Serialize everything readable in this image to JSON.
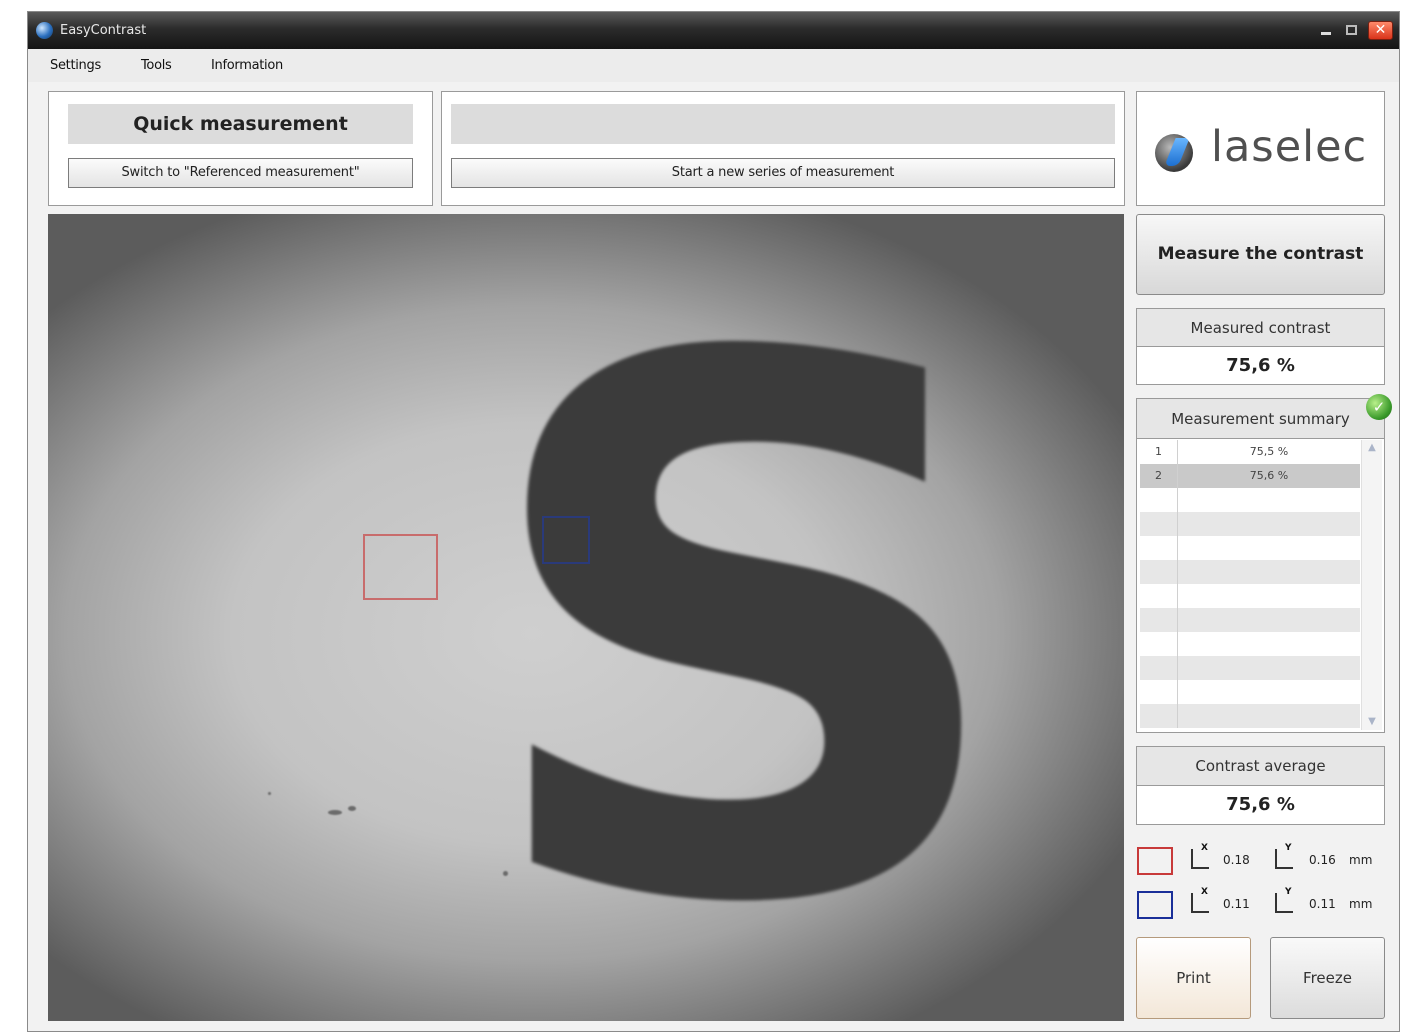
{
  "window": {
    "title": "EasyContrast",
    "close_glyph": "✕"
  },
  "menu": {
    "items": [
      "Settings",
      "Tools",
      "Information"
    ]
  },
  "mode": {
    "title": "Quick measurement",
    "switch_button": "Switch to \"Referenced measurement\""
  },
  "series": {
    "start_button": "Start a new series of measurement"
  },
  "logo": {
    "text": "laselec"
  },
  "actions": {
    "measure_button": "Measure the contrast",
    "print_button": "Print",
    "freeze_button": "Freeze"
  },
  "measured": {
    "label": "Measured contrast",
    "value": "75,6 %"
  },
  "summary": {
    "label": "Measurement summary",
    "rows": [
      {
        "index": "1",
        "value": "75,5 %"
      },
      {
        "index": "2",
        "value": "75,6 %"
      }
    ],
    "status_icon": "check-icon"
  },
  "average": {
    "label": "Contrast average",
    "value": "75,6 %"
  },
  "zones": {
    "red": {
      "color": "#c83a3a",
      "x_label": "X",
      "x_value": "0.18",
      "y_label": "Y",
      "y_value": "0.16",
      "unit": "mm"
    },
    "blue": {
      "color": "#1a2f99",
      "x_label": "X",
      "x_value": "0.11",
      "y_label": "Y",
      "y_value": "0.11",
      "unit": "mm"
    }
  }
}
